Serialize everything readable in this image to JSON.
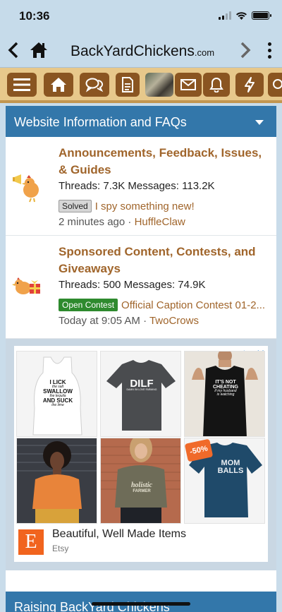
{
  "status": {
    "time": "10:36"
  },
  "browser": {
    "site_name": "BackYardChickens",
    "site_tld": ".com"
  },
  "section": {
    "title": "Website Information and FAQs"
  },
  "nodes": [
    {
      "title": "Announcements, Feedback, Issues, & Guides",
      "threads_label": "Threads:",
      "threads": "7.3K",
      "messages_label": "Messages:",
      "messages": "113.2K",
      "prefix": "Solved",
      "latest_thread": "I spy something new!",
      "time": "2 minutes ago",
      "user": "HuffleClaw"
    },
    {
      "title": "Sponsored Content, Contests, and Giveaways",
      "threads_label": "Threads:",
      "threads": "500",
      "messages_label": "Messages:",
      "messages": "74.9K",
      "prefix": "Open Contest",
      "latest_thread": "Official Caption Contest 01-2...",
      "time": "Today at 9:05 AM",
      "user": "TwoCrows"
    }
  ],
  "ad": {
    "headline": "Beautiful, Well Made Items",
    "brand": "Etsy",
    "logo_letter": "E",
    "products": [
      {
        "lines": [
          "I LICK",
          "the salt",
          "SWALLOW",
          "the tequila",
          "AND SUCK",
          "the lime"
        ]
      },
      {
        "lines": [
          "DILF",
          "DAMN I'M LOVE FARMING"
        ]
      },
      {
        "lines": [
          "IT'S NOT",
          "CHEATING",
          "if my husband",
          "is watching"
        ]
      },
      {
        "lines": []
      },
      {
        "lines": [
          "holistic",
          "FARMER"
        ]
      },
      {
        "lines": [
          "MOM BALLS"
        ],
        "discount": "-50%"
      }
    ]
  },
  "section2": {
    "title": "Raising BackYard Chickens"
  },
  "colors": {
    "link": "#a0652b",
    "header_blue": "#3377aa",
    "toolbar_brown": "#8a5521",
    "toolbar_bg": "#e7c88b"
  }
}
